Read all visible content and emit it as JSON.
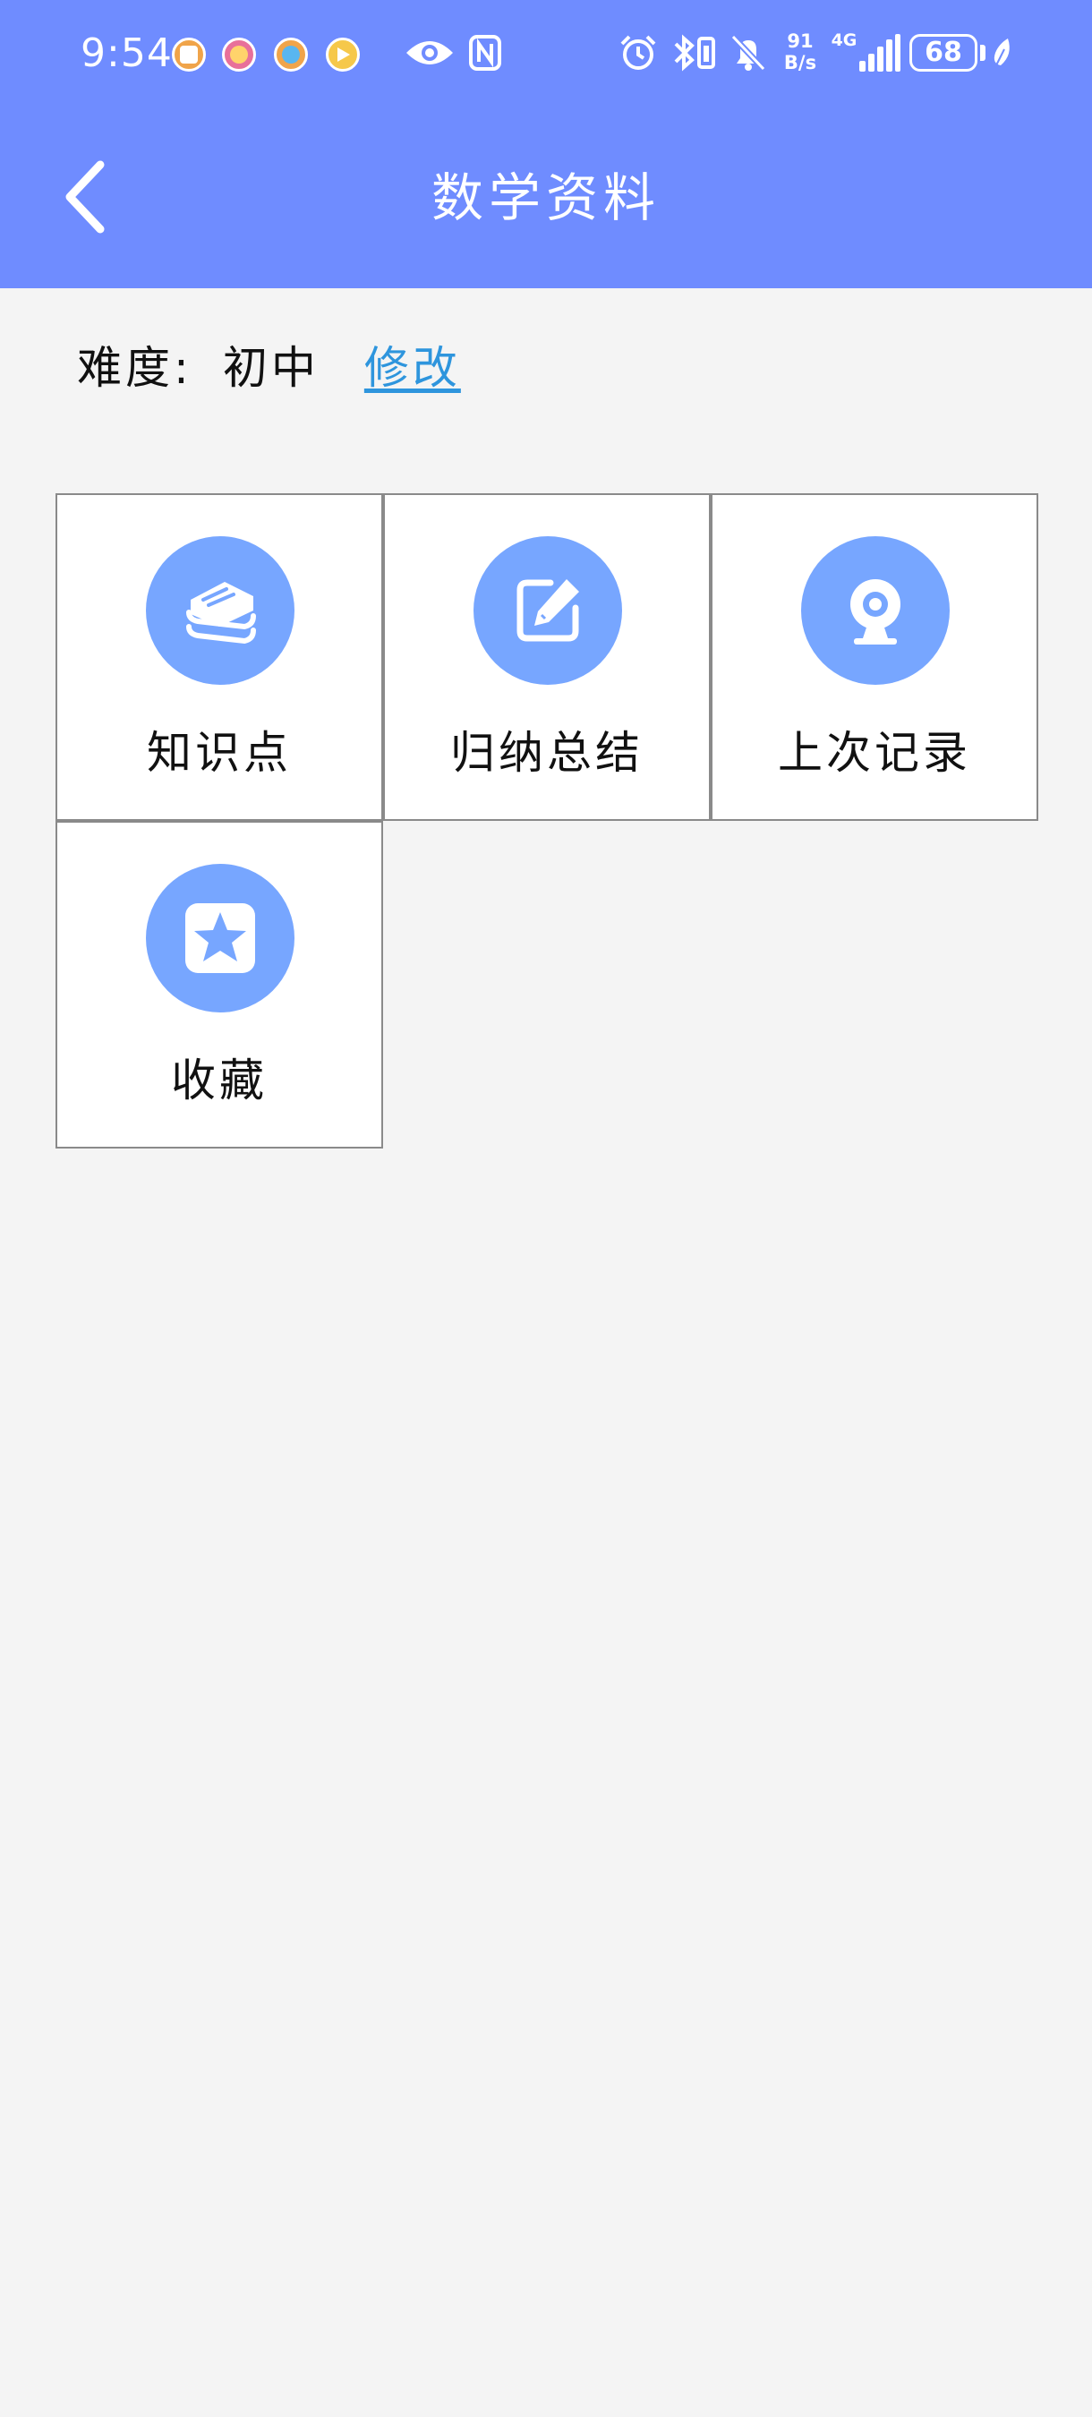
{
  "status_bar": {
    "time": "9:54",
    "notification_icons": [
      "photo-app-icon",
      "shop-app-icon",
      "map-app-icon",
      "video-app-icon"
    ],
    "system_icons": [
      "eye-icon",
      "nfc-icon",
      "alarm-icon",
      "bluetooth-icon",
      "mute-bell-icon"
    ],
    "net_speed_value": "91",
    "net_speed_unit": "B/s",
    "network_type": "4G",
    "battery": "68"
  },
  "header": {
    "title": "数学资料",
    "background_color": "#6f8cff"
  },
  "difficulty": {
    "label": "难度:",
    "value": "初中",
    "edit_label": "修改",
    "link_color": "#2e95dd"
  },
  "menu": {
    "icon_bg_color": "#77a6ff",
    "items": [
      {
        "label": "知识点",
        "icon": "books-icon"
      },
      {
        "label": "归纳总结",
        "icon": "edit-note-icon"
      },
      {
        "label": "上次记录",
        "icon": "webcam-icon"
      },
      {
        "label": "收藏",
        "icon": "star-icon"
      }
    ]
  }
}
